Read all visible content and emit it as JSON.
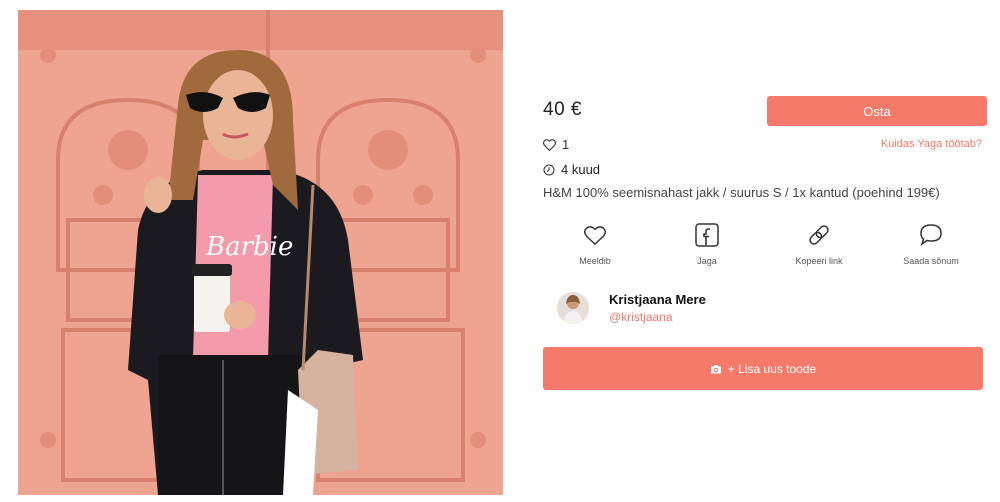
{
  "product": {
    "price": "40 €",
    "buy_label": "Osta",
    "likes_count": "1",
    "help_link": "Kuidas Yaga töötab?",
    "age": "4 kuud",
    "description": "H&M 100% seemisnahast jakk / suurus S / 1x kantud (poehind 199€)"
  },
  "actions": [
    {
      "label": "Meeldib",
      "icon": "heart-icon"
    },
    {
      "label": "Jaga",
      "icon": "facebook-icon"
    },
    {
      "label": "Kopeeri link",
      "icon": "link-icon"
    },
    {
      "label": "Saada sõnum",
      "icon": "chat-icon"
    }
  ],
  "seller": {
    "name": "Kristjaana Mere",
    "handle": "@kristjaana"
  },
  "add_product_label": "+ Lisa uus toode",
  "colors": {
    "accent": "#f67a6a",
    "link": "#f0776a",
    "door_pink": "#f0a593"
  }
}
